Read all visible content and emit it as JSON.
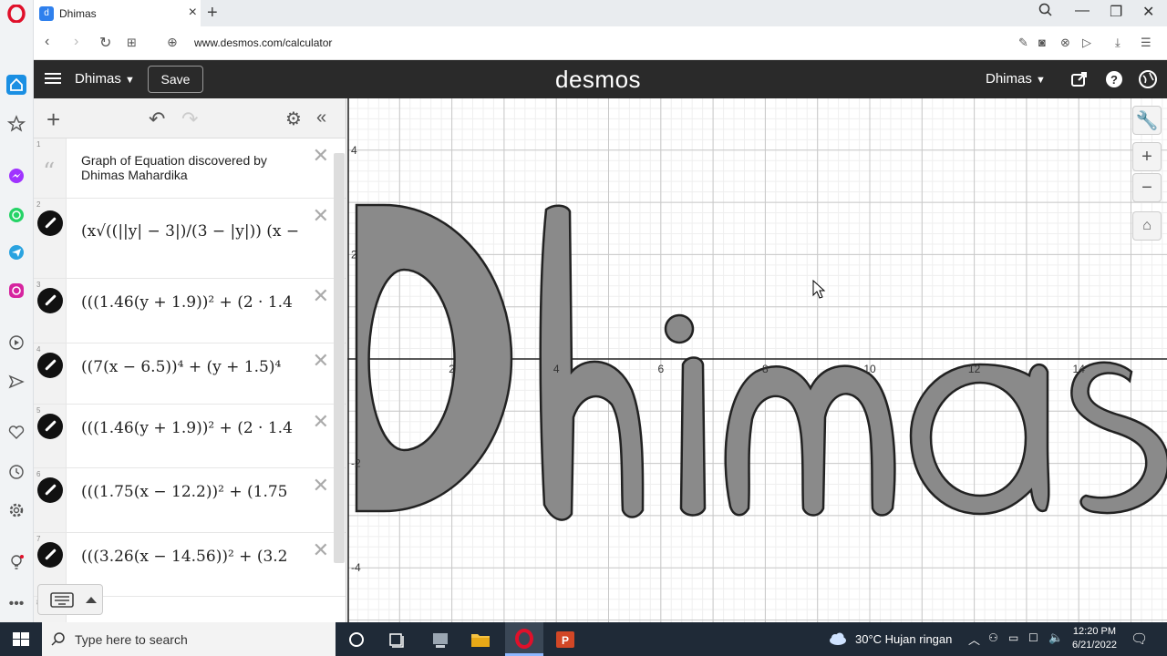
{
  "browser": {
    "tab_title": "Dhimas",
    "url": "www.desmos.com/calculator"
  },
  "desmos": {
    "graph_name": "Dhimas",
    "save_label": "Save",
    "logo": "desmos",
    "user_name": "Dhimas"
  },
  "expressions": [
    {
      "num": "1",
      "type": "note",
      "text": "Graph of Equation discovered by Dhimas Mahardika"
    },
    {
      "num": "2",
      "type": "expr",
      "text": "(x√((||y| − 3|)/(3 − |y|)) (x − √(9 − y²))"
    },
    {
      "num": "3",
      "type": "expr",
      "text": "(((1.46(y + 1.9))² + (2 · 1.4"
    },
    {
      "num": "4",
      "type": "expr",
      "text": "((7(x − 6.5))⁴ + (y + 1.5)⁴"
    },
    {
      "num": "5",
      "type": "expr",
      "text": "(((1.46(y + 1.9))² + (2 · 1.4"
    },
    {
      "num": "6",
      "type": "expr",
      "text": "(((1.75(x − 12.2))² + (1.75"
    },
    {
      "num": "7",
      "type": "expr",
      "text": "(((3.26(x − 14.56))² + (3.2"
    },
    {
      "num": "8",
      "type": "expr",
      "text": ""
    }
  ],
  "axes": {
    "x_ticks": [
      "0",
      "2",
      "4",
      "6",
      "8",
      "10",
      "12",
      "14"
    ],
    "y_ticks": [
      "4",
      "2",
      "-2",
      "-4"
    ]
  },
  "taskbar": {
    "search_placeholder": "Type here to search",
    "weather": "30°C  Hujan ringan",
    "time": "12:20 PM",
    "date": "6/21/2022"
  },
  "colors": {
    "header_bg": "#2a2a2a",
    "shape_fill": "#8a8a8a",
    "taskbar_bg": "#1f2a37"
  }
}
